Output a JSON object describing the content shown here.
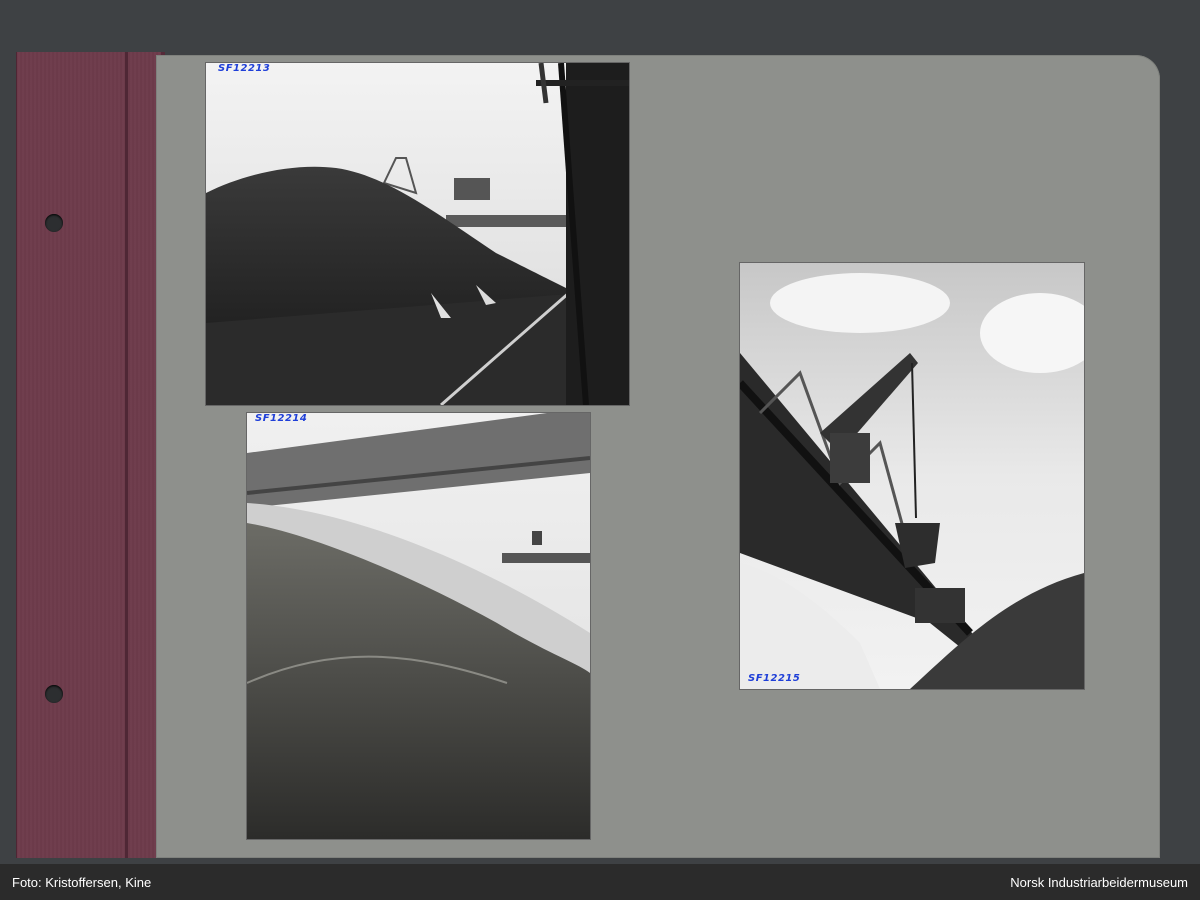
{
  "album": {
    "photos": [
      {
        "code": "SF12213",
        "subject": "coal-pile"
      },
      {
        "code": "SF12214",
        "subject": "ore-pile-under-conveyor"
      },
      {
        "code": "SF12215",
        "subject": "crane-with-grab-bucket"
      }
    ]
  },
  "footer": {
    "photo_credit": "Foto: Kristoffersen, Kine",
    "museum_name": "Norsk Industriarbeidermuseum"
  }
}
